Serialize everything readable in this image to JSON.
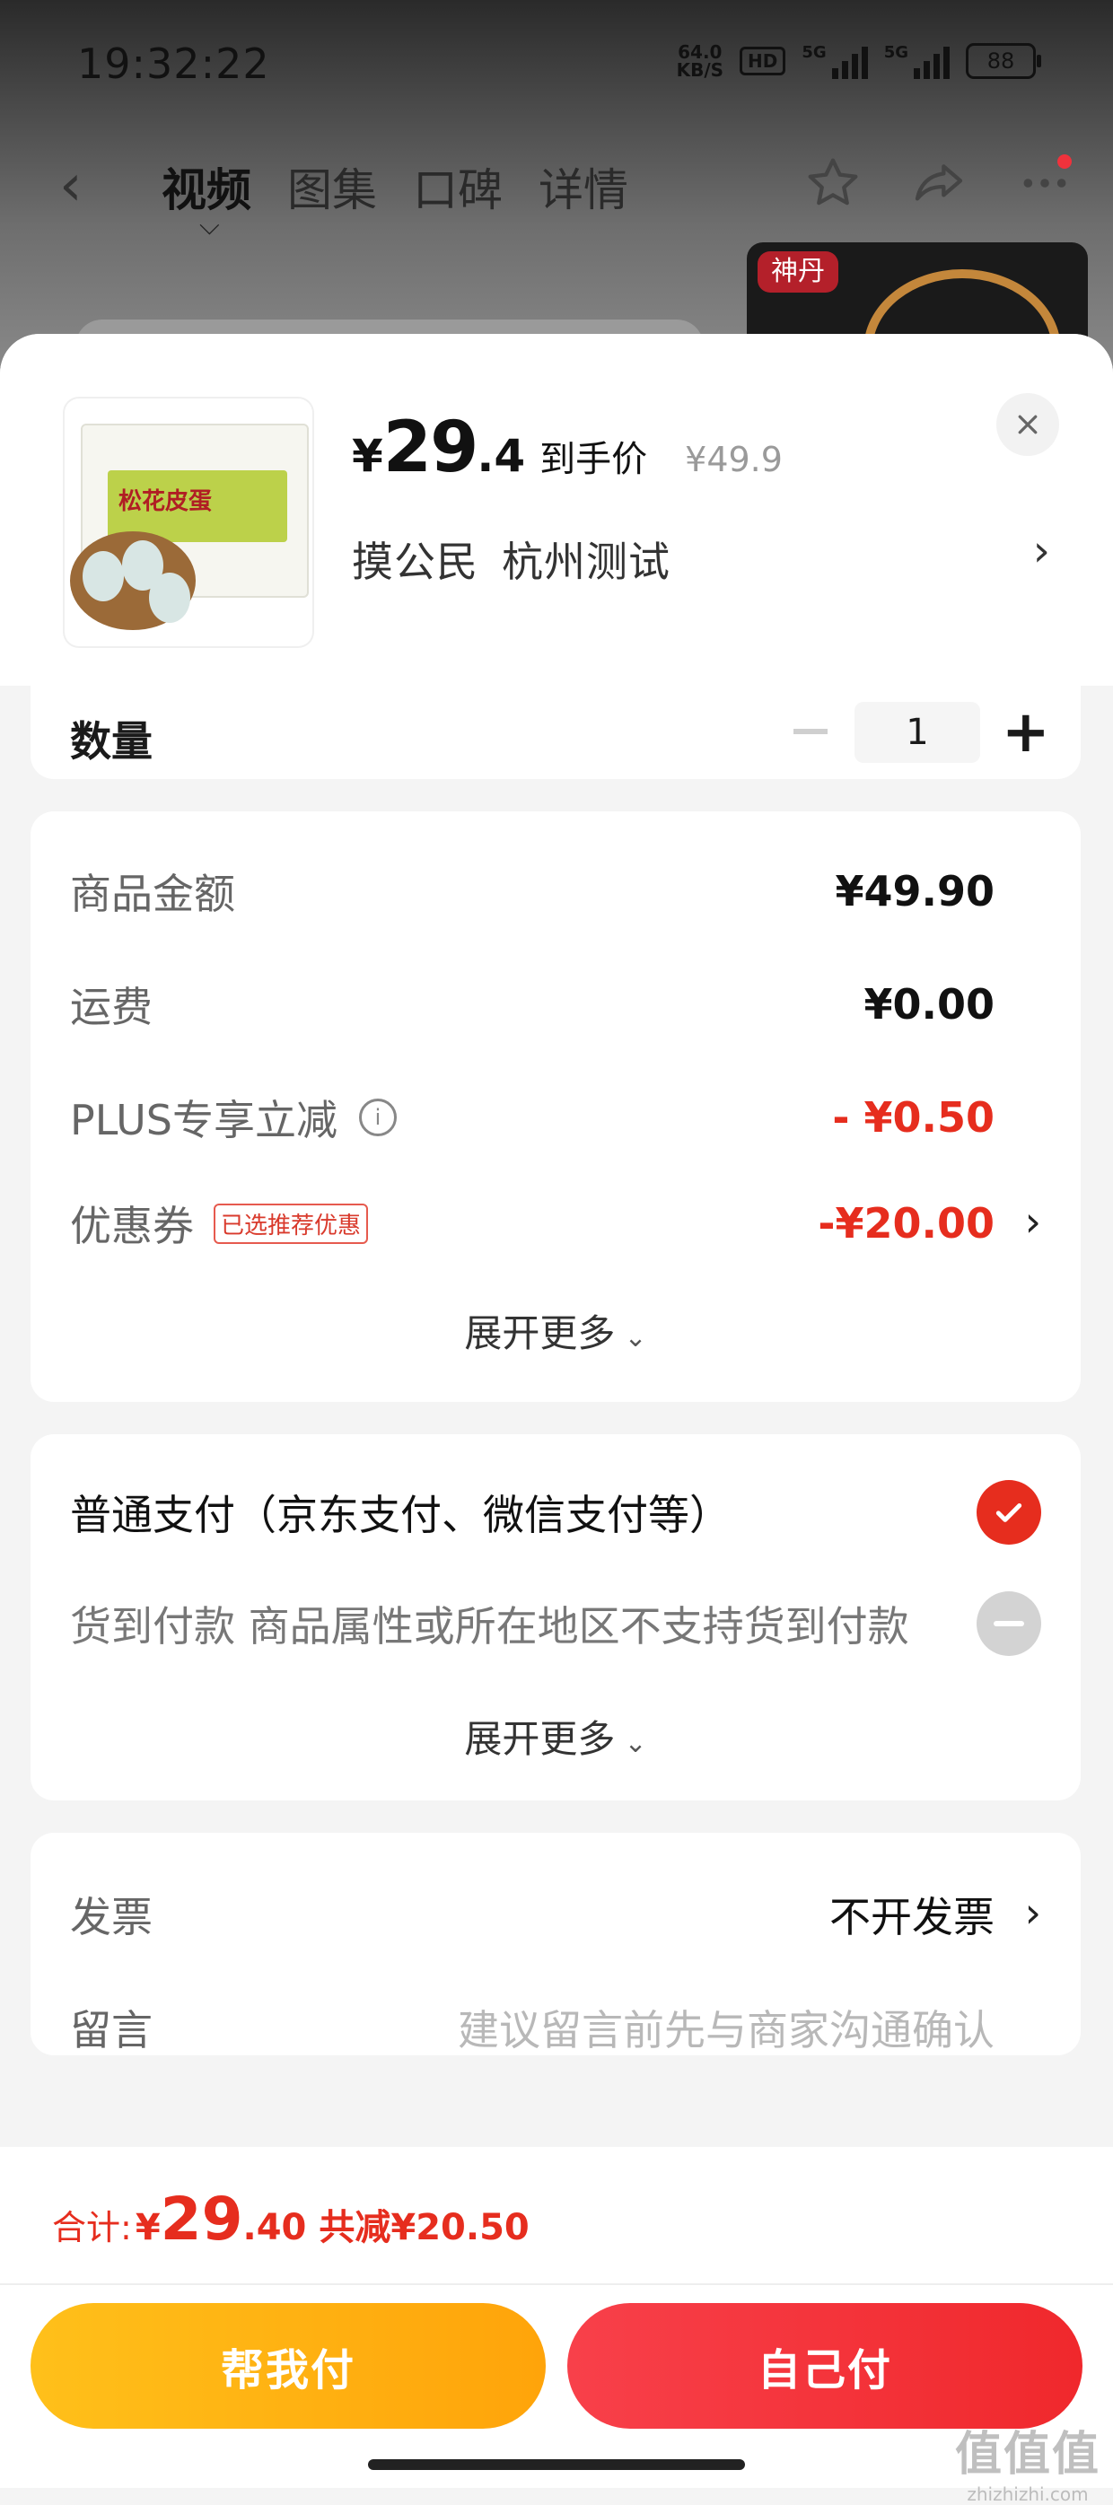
{
  "status_bar": {
    "time": "19:32:22",
    "net_speed_value": "64.0",
    "net_speed_unit": "KB/S",
    "hd_badge": "HD",
    "signal1_label": "5G",
    "signal2_label": "5G",
    "battery": "88"
  },
  "nav": {
    "tabs": [
      {
        "label": "视频"
      },
      {
        "label": "图集"
      },
      {
        "label": "口碑"
      },
      {
        "label": "详情"
      }
    ],
    "active_tab": "视频"
  },
  "product": {
    "image_label": "松花皮蛋",
    "thumb_seal": "神丹"
  },
  "price": {
    "currency": "¥",
    "main": "29",
    "decimal": ".4",
    "tag": "到手价",
    "original": "¥49.9"
  },
  "address": {
    "name": "摸公民",
    "location": "杭州测试"
  },
  "quantity": {
    "label": "数量",
    "value": "1"
  },
  "amounts": {
    "goods_label": "商品金额",
    "goods_value": "¥49.90",
    "shipping_label": "运费",
    "shipping_value": "¥0.00",
    "plus_label": "PLUS专享立减",
    "plus_value": "- ¥0.50",
    "coupon_label": "优惠券",
    "coupon_tag": "已选推荐优惠",
    "coupon_value": "-¥20.00",
    "expand": "展开更多"
  },
  "payment": {
    "normal_label": "普通支付（京东支付、微信支付等）",
    "cod_label": "货到付款 商品属性或所在地区不支持货到付款",
    "expand": "展开更多"
  },
  "misc": {
    "invoice_label": "发票",
    "invoice_value": "不开发票",
    "note_label": "留言",
    "note_placeholder": "建议留言前先与商家沟通确认"
  },
  "footer": {
    "total_label": "合计:",
    "total_currency": "¥",
    "total_main": "29",
    "total_decimal": ".40",
    "total_saved": "共减¥20.50",
    "help_pay_label": "帮我付",
    "self_pay_label": "自己付"
  },
  "watermark": {
    "big": "值值值",
    "small": "zhizhizhi.com"
  },
  "colors": {
    "accent_red": "#e62d1e",
    "help_button": "#ffb014",
    "self_button": "#f3343a"
  }
}
